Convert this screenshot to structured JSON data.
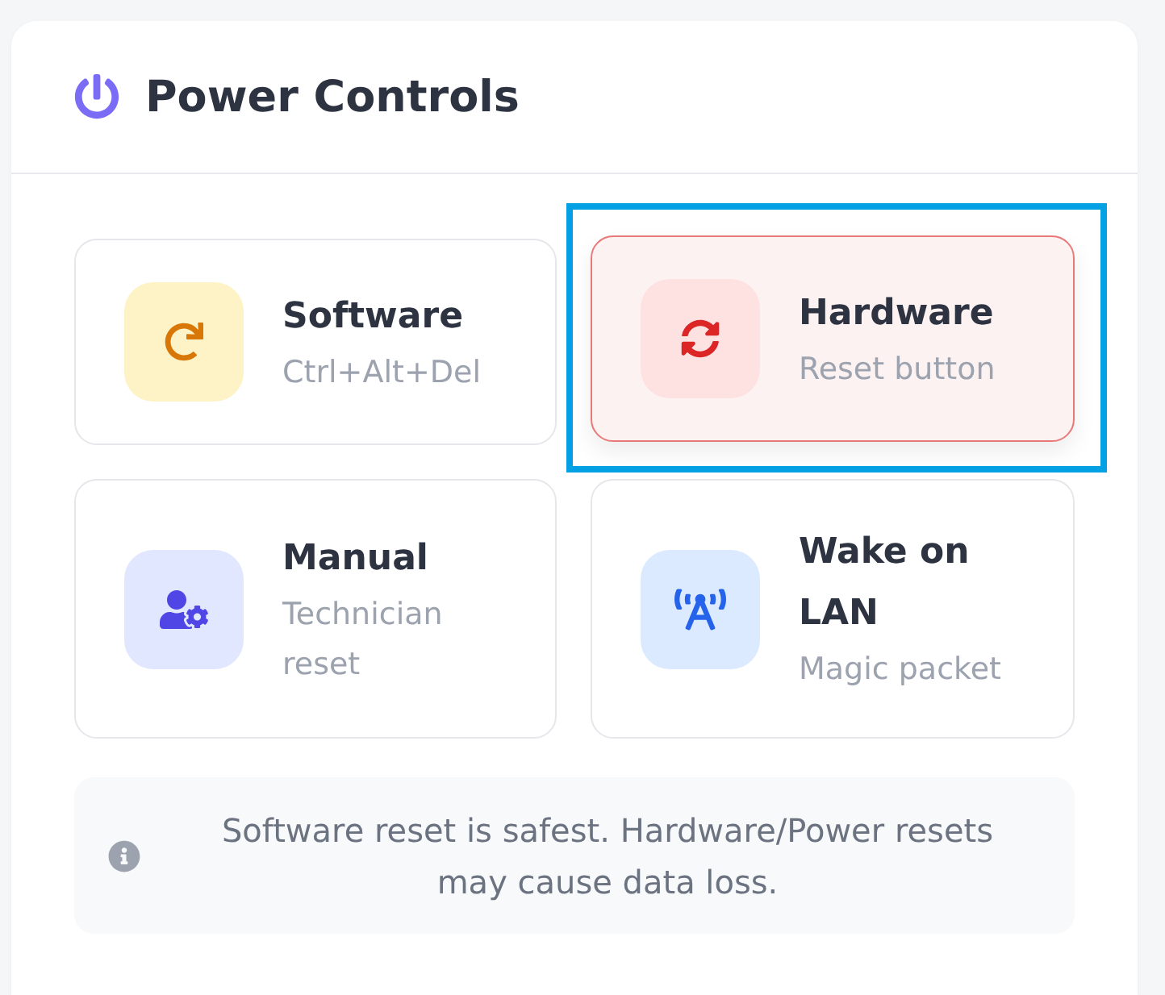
{
  "header": {
    "title": "Power Controls"
  },
  "options": [
    {
      "kind": "software",
      "title": "Software",
      "subtitle": "Ctrl+Alt+Del",
      "color": "#d97706",
      "selected": false,
      "focused": false
    },
    {
      "kind": "hardware",
      "title": "Hardware",
      "subtitle": "Reset button",
      "color": "#dc2626",
      "selected": true,
      "focused": true
    },
    {
      "kind": "manual",
      "title": "Manual",
      "subtitle": "Technician reset",
      "color": "#4f46e5",
      "selected": false,
      "focused": false
    },
    {
      "kind": "wake",
      "title": "Wake on LAN",
      "subtitle": "Magic packet",
      "color": "#2563eb",
      "selected": false,
      "focused": false
    }
  ],
  "notice": {
    "text": "Software reset is safest. Hardware/Power resets may cause data loss."
  }
}
